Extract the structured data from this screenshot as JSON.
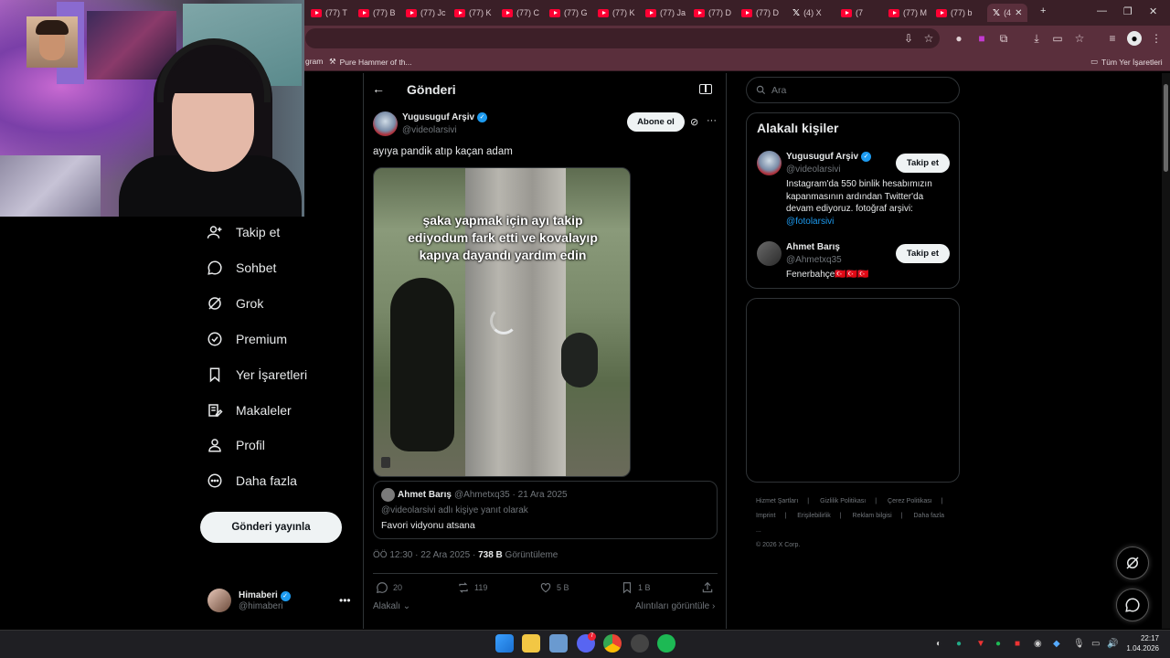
{
  "browser": {
    "tabs": [
      {
        "label": "(77) T",
        "icon": "youtube"
      },
      {
        "label": "(77) B",
        "icon": "youtube"
      },
      {
        "label": "(77) Jc",
        "icon": "youtube"
      },
      {
        "label": "(77) K",
        "icon": "youtube"
      },
      {
        "label": "(77) C",
        "icon": "youtube"
      },
      {
        "label": "(77) G",
        "icon": "youtube"
      },
      {
        "label": "(77) K",
        "icon": "youtube"
      },
      {
        "label": "(77) Ja",
        "icon": "youtube"
      },
      {
        "label": "(77) D",
        "icon": "youtube"
      },
      {
        "label": "(77) D",
        "icon": "youtube"
      },
      {
        "label": "(4) X",
        "icon": "x"
      },
      {
        "label": "(7",
        "icon": "youtube"
      },
      {
        "label": "(77) M",
        "icon": "youtube"
      },
      {
        "label": "(77) b",
        "icon": "youtube"
      },
      {
        "label": "(4",
        "icon": "x",
        "active": true
      }
    ],
    "new_tab": "+",
    "bookmarks": [
      {
        "label": "gram"
      },
      {
        "label": "Pure Hammer of th..."
      }
    ],
    "all_bookmarks": "Tüm Yer İşaretleri"
  },
  "nav": {
    "items": [
      {
        "label": "Takip et",
        "icon": "follow-icon"
      },
      {
        "label": "Sohbet",
        "icon": "chat-icon"
      },
      {
        "label": "Grok",
        "icon": "grok-icon"
      },
      {
        "label": "Premium",
        "icon": "premium-icon"
      },
      {
        "label": "Yer İşaretleri",
        "icon": "bookmark-icon"
      },
      {
        "label": "Makaleler",
        "icon": "articles-icon"
      },
      {
        "label": "Profil",
        "icon": "profile-icon"
      },
      {
        "label": "Daha fazla",
        "icon": "more-icon"
      }
    ],
    "post_button": "Gönderi yayınla",
    "me": {
      "name": "Himaberi",
      "handle": "@himaberi"
    }
  },
  "post": {
    "header": "Gönderi",
    "author": {
      "name": "Yugusuguf Arşiv",
      "handle": "@videolarsivi"
    },
    "subscribe": "Abone ol",
    "text": "ayıya pandik atıp kaçan adam",
    "video_caption": "şaka yapmak için ayı takip ediyodum fark etti ve kovalayıp kapıya dayandı yardım edin",
    "quote": {
      "name": "Ahmet Barış",
      "handle": "@Ahmetxq35",
      "date": "· 21 Ara 2025",
      "reply_to": "@videolarsivi adlı kişiye yanıt olarak",
      "text": "Favori vidyonu atsana"
    },
    "meta": {
      "time": "ÖÖ 12:30 · 22 Ara 2025 · ",
      "views": "738 B",
      "views_label": " Görüntüleme"
    },
    "actions": {
      "replies": "20",
      "reposts": "119",
      "likes": "5 B",
      "bookmarks": "1 B"
    },
    "related": "Alakalı",
    "quotes": "Alıntıları görüntüle"
  },
  "sidebar": {
    "search_placeholder": "Ara",
    "relevant_title": "Alakalı kişiler",
    "people": [
      {
        "name": "Yugusuguf Arşiv",
        "handle": "@videolarsivi",
        "verified": true,
        "bio": "Instagram'da 550 binlik hesabımızın kapanmasının ardından Twitter'da devam ediyoruz. fotoğraf arşivi: ",
        "bio_link": "@fotolarsivi",
        "follow": "Takip et"
      },
      {
        "name": "Ahmet Barış",
        "handle": "@Ahmetxq35",
        "verified": false,
        "bio": "Fenerbahçe🇹🇷🇹🇷🇹🇷",
        "follow": "Takip et"
      }
    ],
    "footer": [
      "Hizmet Şartları",
      "|",
      "Gizlilik Politikası",
      "|",
      "Çerez Politikası",
      "|",
      "Imprint",
      "|",
      "Erişilebilirlik",
      "|",
      "Reklam bilgisi",
      "|",
      "Daha fazla ...",
      "© 2026 X Corp."
    ]
  },
  "taskbar": {
    "time": "22:17",
    "date": "1.04.2026",
    "discord_badge": "7"
  },
  "colors": {
    "accent": "#1d9bf0",
    "chrome": "#5a2f3c",
    "tabbar": "#3a1f27"
  }
}
